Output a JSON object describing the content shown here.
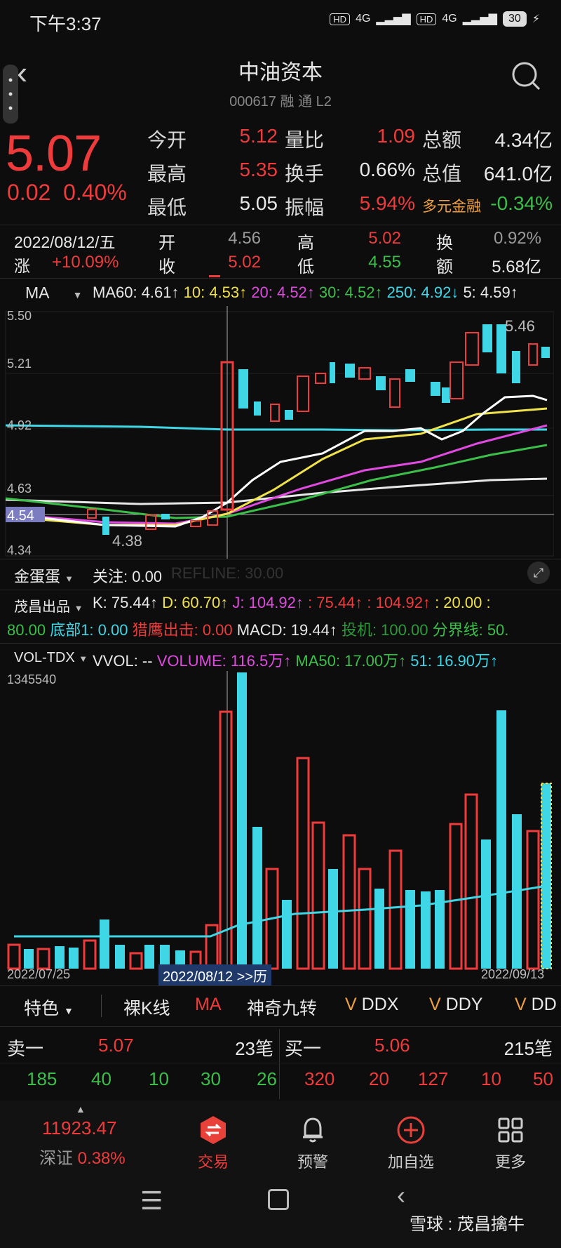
{
  "status": {
    "time": "下午3:37",
    "hd1": "HD",
    "net1": "4G",
    "hd2": "HD",
    "net2": "4G",
    "battery": "30"
  },
  "header": {
    "name": "中油资本",
    "code": "000617 融 通 L2"
  },
  "quote": {
    "price": "5.07",
    "change": "0.02",
    "change_pct": "0.40%",
    "jinkai_lbl": "今开",
    "jinkai": "5.12",
    "zuigao_lbl": "最高",
    "zuigao": "5.35",
    "zuidi_lbl": "最低",
    "zuidi": "5.05",
    "liangbi_lbl": "量比",
    "liangbi": "1.09",
    "huanshou_lbl": "换手",
    "huanshou": "0.66%",
    "zhenfu_lbl": "振幅",
    "zhenfu": "5.94%",
    "zonge_lbl": "总额",
    "zonge": "4.34亿",
    "zongzhi_lbl": "总值",
    "zongzhi": "641.0亿",
    "sector_lbl": "多元金融",
    "sector_val": "-0.34%"
  },
  "day": {
    "date": "2022/08/12/五",
    "zhang_lbl": "涨",
    "zhang": "+10.09%",
    "kai_lbl": "开",
    "kai": "4.56",
    "shou_lbl": "收",
    "shou": "5.02",
    "gao_lbl": "高",
    "gao": "5.02",
    "di_lbl": "低",
    "di": "4.55",
    "huan_lbl": "换",
    "huan": "0.92%",
    "e_lbl": "额",
    "e": "5.68亿"
  },
  "ma_bar": {
    "selector": "MA",
    "ma60": "MA60: 4.61↑",
    "ma10": "10: 4.53↑",
    "ma20": "20: 4.52↑",
    "ma30": "30: 4.52↑",
    "ma250": "250: 4.92↓",
    "ma5": "5: 4.59↑"
  },
  "kline_axis": {
    "y1": "5.50",
    "y2": "5.21",
    "y3": "4.92",
    "y4": "4.63",
    "y5": "4.54",
    "y6": "4.34",
    "hi_label": "5.46",
    "lo_label": "4.38"
  },
  "ind1": {
    "name": "金蛋蛋",
    "guanzhu": "关注: 0.00",
    "refline": "REFLINE: 30.00"
  },
  "ind2": {
    "name": "茂昌出品",
    "k": "K: 75.44↑",
    "d": "D: 60.70↑",
    "j": "J: 104.92↑",
    "v1": ": 75.44↑",
    "v2": ": 104.92↑",
    "v3": ": 20.00 :",
    "v4": "80.00",
    "dibu": "底部1: 0.00",
    "lieying": "猎鹰出击: 0.00",
    "macd": "MACD: 19.44↑",
    "touji": "投机: 100.00",
    "fenjie": "分界线: 50."
  },
  "vol_bar": {
    "name": "VOL-TDX",
    "vvol": "VVOL: --",
    "volume": "VOLUME: 116.5万↑",
    "ma50": "MA50: 17.00万↑",
    "v51": "51: 16.90万↑",
    "ymax": "1345540"
  },
  "vol_axis": {
    "start": "2022/07/25",
    "mid": "2022/08/12 >>历",
    "end": "2022/09/13"
  },
  "tabs": {
    "tese": "特色",
    "luok": "裸K线",
    "ma": "MA",
    "shenqi": "神奇九转",
    "ddx": "DDX",
    "ddy": "DDY",
    "ddz": "DD"
  },
  "orderbook": {
    "sell_lbl": "卖一",
    "sell_price": "5.07",
    "sell_count": "23笔",
    "buy_lbl": "买一",
    "buy_price": "5.06",
    "buy_count": "215笔",
    "sell_q": [
      "185",
      "40",
      "10",
      "30",
      "26"
    ],
    "buy_q": [
      "320",
      "20",
      "127",
      "10",
      "50"
    ]
  },
  "nav": {
    "index_val": "11923.47",
    "index_name": "深证",
    "index_pct": "0.38%",
    "trade": "交易",
    "alert": "预警",
    "add": "加自选",
    "more": "更多"
  },
  "watermark": "雪球 : 茂昌擒牛",
  "colors": {
    "up": "#ef3b3b",
    "down": "#3fd6e6",
    "green": "#3bbf4a",
    "yellow": "#f0e24a",
    "magenta": "#e04ae0"
  }
}
